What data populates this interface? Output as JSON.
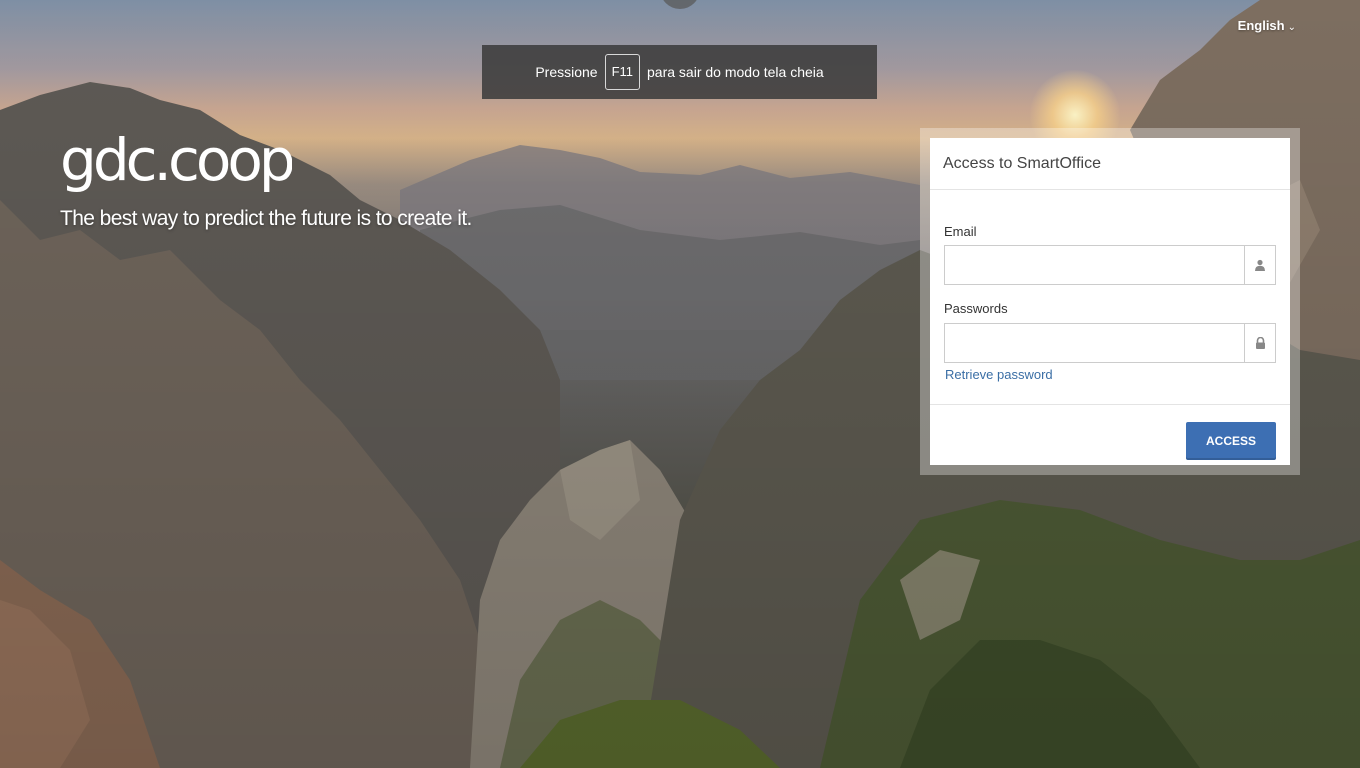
{
  "language": {
    "current": "English",
    "chevron": "⌄"
  },
  "fullscreen_notice": {
    "prefix": "Pressione",
    "key": "F11",
    "suffix": "para sair do modo tela cheia"
  },
  "brand": {
    "logo_text": "gdc.coop",
    "tagline": "The best way to predict the future is to create it."
  },
  "login": {
    "title": "Access to SmartOffice",
    "email_label": "Email",
    "email_value": "",
    "email_icon": "user-icon",
    "password_label": "Passwords",
    "password_value": "",
    "password_icon": "lock-icon",
    "retrieve_link": "Retrieve password",
    "submit_label": "ACCESS",
    "submit_color": "#3d6fb3"
  }
}
